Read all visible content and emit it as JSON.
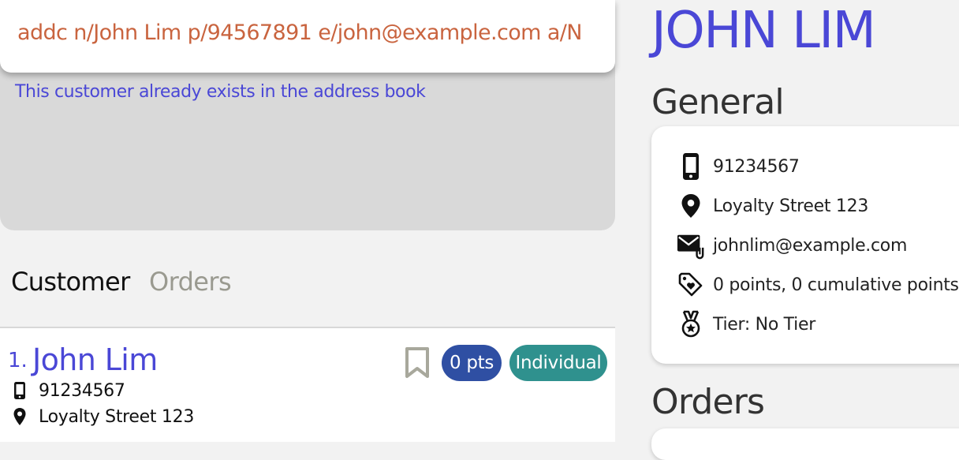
{
  "command_box": {
    "value": "addc n/John Lim p/94567891 e/john@example.com a/N"
  },
  "result_display": {
    "message": "This customer already exists in the address book"
  },
  "tabs": [
    {
      "label": "Customer",
      "active": true
    },
    {
      "label": "Orders",
      "active": false
    }
  ],
  "customer_list": [
    {
      "index": "1.",
      "name": "John Lim",
      "points_badge": "0 pts",
      "type_badge": "Individual",
      "phone": "91234567",
      "address": "Loyalty Street 123",
      "bookmark_icon": "bookmark-outline-icon"
    }
  ],
  "detail": {
    "name": "JOHN LIM",
    "general_title": "General",
    "phone": "91234567",
    "address": "Loyalty Street 123",
    "email": "johnlim@example.com",
    "points": "0 points, 0 cumulative points",
    "tier": "Tier: No Tier",
    "orders_title": "Orders"
  },
  "icons": {
    "phone": "phone-icon",
    "address": "location-pin-icon",
    "email": "email-icon",
    "points": "tag-icon",
    "tier": "medal-icon"
  },
  "colors": {
    "accent": "#4a47d6",
    "command_text": "#c9643f",
    "points_badge": "#2f4fa3",
    "type_badge": "#2f918e",
    "inactive_tab": "#9a9a90"
  }
}
